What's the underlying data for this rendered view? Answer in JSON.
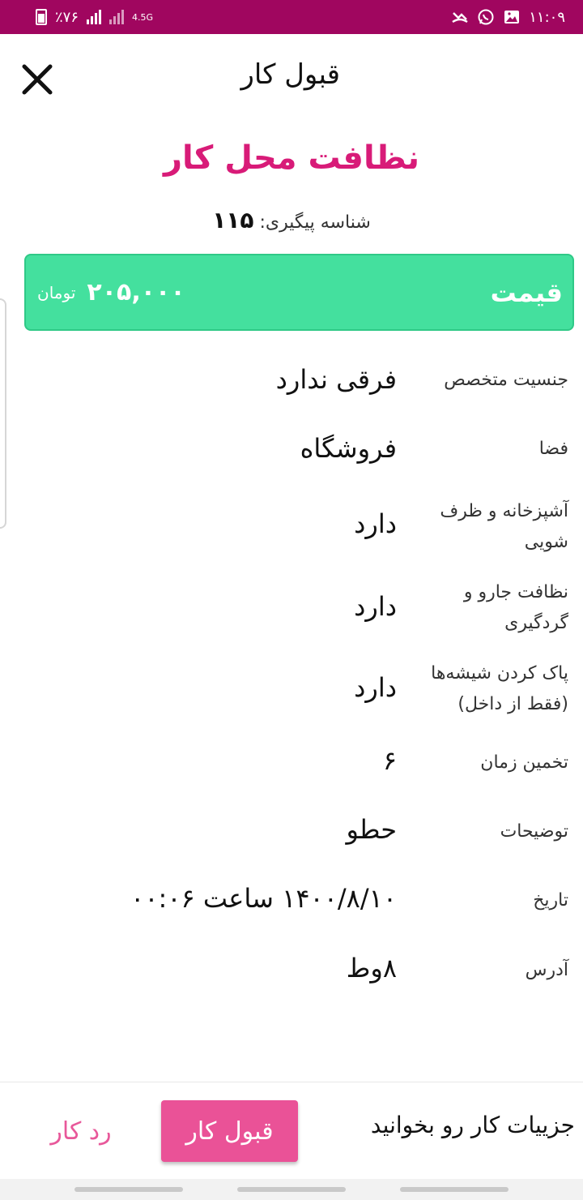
{
  "status_bar": {
    "battery": "٪۷۶",
    "network": "4.5G",
    "time": "۱۱:۰۹",
    "icons": [
      "missed-call-icon",
      "whatsapp-icon",
      "gallery-icon"
    ]
  },
  "header": {
    "title": "قبول کار",
    "close_icon": "close-icon"
  },
  "job": {
    "title": "نظافت محل کار",
    "tracking_label": "شناسه پیگیری:",
    "tracking_number": "۱۱۵"
  },
  "price": {
    "label": "قیمت",
    "amount": "۲۰۵,۰۰۰",
    "unit": "تومان"
  },
  "details": [
    {
      "label": "جنسیت متخصص",
      "value": "فرقی ندارد"
    },
    {
      "label": "فضا",
      "value": "فروشگاه"
    },
    {
      "label": "آشپزخانه و ظرف شویی",
      "value": "دارد"
    },
    {
      "label": "نظافت جارو و گردگیری",
      "value": "دارد"
    },
    {
      "label": "پاک کردن شیشه‌ها (فقط از داخل)",
      "value": "دارد"
    },
    {
      "label": "تخمین زمان",
      "value": "۶"
    },
    {
      "label": "توضیحات",
      "value": "حطو"
    },
    {
      "label": "تاریخ",
      "value": "۱۴۰۰/۸/۱۰ ساعت ۰۰:۰۶"
    },
    {
      "label": "آدرس",
      "value": "۸وط"
    }
  ],
  "footer": {
    "hint": "جزییات کار رو بخوانید",
    "accept_label": "قبول کار",
    "reject_label": "رد کار"
  },
  "colors": {
    "status_bar": "#a0065f",
    "accent_pink": "#d81b78",
    "price_green": "#44e09e",
    "accept_button": "#ea5297"
  }
}
